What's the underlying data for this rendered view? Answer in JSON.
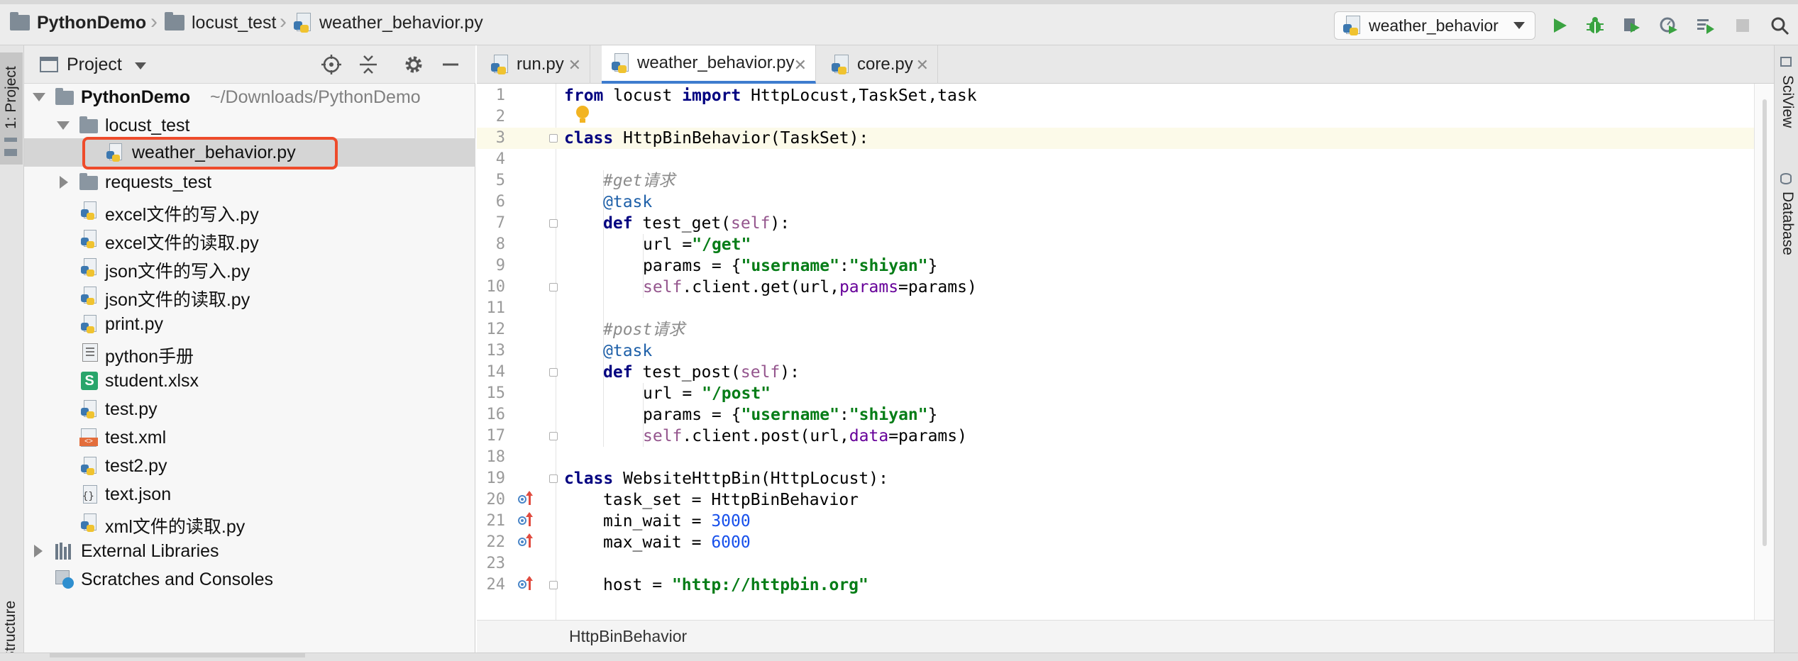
{
  "navbar": {
    "crumbs": [
      "PythonDemo",
      "locust_test",
      "weather_behavior.py"
    ],
    "run_config": "weather_behavior"
  },
  "left_strip": {
    "project_tab": "1: Project",
    "bottom_tab": "Structure"
  },
  "right_strip": {
    "tabs": [
      "SciView",
      "Database"
    ]
  },
  "project_panel": {
    "title": "Project",
    "root": {
      "name": "PythonDemo",
      "path": "~/Downloads/PythonDemo"
    },
    "items": [
      "locust_test",
      "weather_behavior.py",
      "requests_test",
      "excel文件的写入.py",
      "excel文件的读取.py",
      "json文件的写入.py",
      "json文件的读取.py",
      "print.py",
      "python手册",
      "student.xlsx",
      "test.py",
      "test.xml",
      "test2.py",
      "text.json",
      "xml文件的读取.py"
    ],
    "external_libraries": "External Libraries",
    "scratches": "Scratches and Consoles",
    "selected_item": "weather_behavior.py"
  },
  "tabs": [
    {
      "label": "run.py",
      "active": false
    },
    {
      "label": "weather_behavior.py",
      "active": true
    },
    {
      "label": "core.py",
      "active": false
    }
  ],
  "editor": {
    "line_numbers": [
      "1",
      "2",
      "3",
      "4",
      "5",
      "6",
      "7",
      "8",
      "9",
      "10",
      "11",
      "12",
      "13",
      "14",
      "15",
      "16",
      "17",
      "18",
      "19",
      "20",
      "21",
      "22",
      "23",
      "24"
    ],
    "lines": {
      "l1": [
        "from",
        " locust ",
        "import",
        " HttpLocust,TaskSet,task"
      ],
      "l3": [
        "class",
        " HttpBinBehavior(TaskSet):"
      ],
      "l5": "#get请求",
      "l6": "@task",
      "l7": [
        "def",
        " test_get(",
        "self",
        "):"
      ],
      "l8": [
        "url =",
        "\"/get\""
      ],
      "l9": [
        "params = {",
        "\"username\"",
        ":",
        "\"shiyan\"",
        "}"
      ],
      "l10": [
        "self",
        ".client.get(url,",
        "params",
        "=params)"
      ],
      "l12": "#post请求",
      "l13": "@task",
      "l14": [
        "def",
        " test_post(",
        "self",
        "):"
      ],
      "l15": [
        "url = ",
        "\"/post\""
      ],
      "l16": [
        "params = {",
        "\"username\"",
        ":",
        "\"shiyan\"",
        "}"
      ],
      "l17": [
        "self",
        ".client.post(url,",
        "data",
        "=params)"
      ],
      "l19": [
        "class",
        " WebsiteHttpBin(HttpLocust):"
      ],
      "l20": "task_set = HttpBinBehavior",
      "l21": [
        "min_wait = ",
        "3000"
      ],
      "l22": [
        "max_wait = ",
        "6000"
      ],
      "l24": [
        "host = ",
        "\"http://httpbin.org\""
      ]
    },
    "breadcrumb": "HttpBinBehavior"
  },
  "colors": {
    "keyword": "#000080",
    "string": "#067d17",
    "number": "#1750eb",
    "self": "#94558d",
    "comment": "#8c8c8c",
    "highlight_box": "#ee4b2b",
    "active_tab_underline": "#3e7cce"
  },
  "icons": [
    "folder-icon",
    "python-file-icon",
    "run-icon",
    "debug-icon",
    "coverage-icon",
    "profile-icon",
    "concurrency-icon",
    "stop-icon",
    "search-icon",
    "locate-icon",
    "collapse-icon",
    "gear-icon",
    "hide-icon",
    "bulb-icon",
    "override-icon"
  ]
}
